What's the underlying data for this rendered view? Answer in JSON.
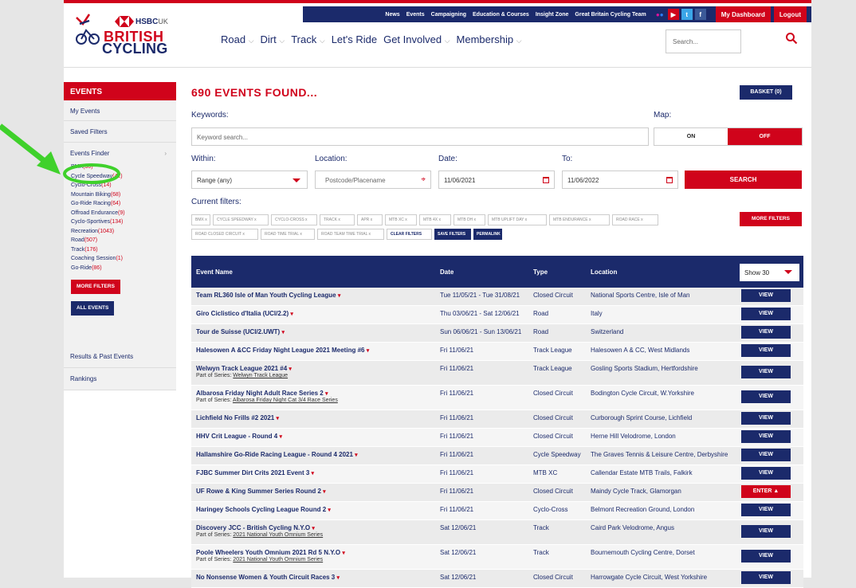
{
  "header": {
    "util_links": [
      "News",
      "Events",
      "Campaigning",
      "Education & Courses",
      "Insight Zone",
      "Great Britain Cycling Team"
    ],
    "my_dashboard": "My Dashboard",
    "logout": "Logout",
    "logo_hsbc": "HSBC",
    "logo_uk": "UK",
    "logo_line1": "BRITISH",
    "logo_line2": "CYCLING",
    "nav": [
      "Road",
      "Dirt",
      "Track",
      "Let's Ride",
      "Get Involved",
      "Membership"
    ],
    "search_placeholder": "Search..."
  },
  "sidebar": {
    "heading": "EVENTS",
    "my_events": "My Events",
    "saved_filters": "Saved Filters",
    "events_finder": "Events Finder",
    "categories": [
      {
        "name": "BMX",
        "count": "(30)"
      },
      {
        "name": "Cycle Speedway",
        "count": "(42)"
      },
      {
        "name": "Cyclo-Cross",
        "count": "(14)"
      },
      {
        "name": "Mountain Biking",
        "count": "(68)"
      },
      {
        "name": "Go-Ride Racing",
        "count": "(64)"
      },
      {
        "name": "Offroad Endurance",
        "count": "(9)"
      },
      {
        "name": "Cyclo-Sportives",
        "count": "(134)"
      },
      {
        "name": "Recreation",
        "count": "(1043)"
      },
      {
        "name": "Road",
        "count": "(507)"
      },
      {
        "name": "Track",
        "count": "(176)"
      },
      {
        "name": "Coaching Session",
        "count": "(1)"
      },
      {
        "name": "Go-Ride",
        "count": "(86)"
      }
    ],
    "more_filters": "MORE FILTERS",
    "all_events": "ALL EVENTS",
    "results": "Results & Past Events",
    "rankings": "Rankings"
  },
  "main": {
    "count_title": "690 EVENTS FOUND...",
    "basket": "BASKET (0)",
    "keywords_label": "Keywords:",
    "keywords_placeholder": "Keyword search...",
    "map_label": "Map:",
    "map_on": "ON",
    "map_off": "OFF",
    "within_label": "Within:",
    "within_value": "Range (any)",
    "location_label": "Location:",
    "location_placeholder": "Postcode/Placename",
    "date_label": "Date:",
    "date_value": "11/06/2021",
    "to_label": "To:",
    "to_value": "11/06/2022",
    "search_button": "SEARCH",
    "current_filters_label": "Current filters:",
    "filters_row1": [
      "BMX  x",
      "CYCLE SPEEDWAY  x",
      "CYCLO-CROSS  x",
      "TRACK  x",
      "APR  x",
      "MTB XC  x",
      "MTB 4X  x",
      "MTB DH  x",
      "MTB UPLIFT DAY  x",
      "MTB ENDURANCE  x",
      "ROAD RACE  x"
    ],
    "filters_row2": [
      "ROAD CLOSED CIRCUIT  x",
      "ROAD TIME TRIAL  x",
      "ROAD TEAM TIME TRIAL  x"
    ],
    "clear_filters": "CLEAR FILTERS",
    "save_filters": "SAVE FILTERS",
    "permalink": "PERMALINK",
    "more_filters": "MORE FILTERS"
  },
  "table": {
    "headers": {
      "name": "Event Name",
      "date": "Date",
      "type": "Type",
      "location": "Location"
    },
    "show": "Show 30",
    "rows": [
      {
        "name": "Team RL360 Isle of Man Youth Cycling League",
        "date": "Tue 11/05/21 - Tue 31/08/21",
        "type": "Closed Circuit",
        "location": "National Sports Centre, Isle of Man",
        "action": "VIEW",
        "series": ""
      },
      {
        "name": "Giro Ciclistico d'Italia (UCI/2.2)",
        "date": "Thu 03/06/21 - Sat 12/06/21",
        "type": "Road",
        "location": "Italy",
        "action": "VIEW",
        "series": ""
      },
      {
        "name": "Tour de Suisse (UCI/2.UWT)",
        "date": "Sun 06/06/21 - Sun 13/06/21",
        "type": "Road",
        "location": "Switzerland",
        "action": "VIEW",
        "series": ""
      },
      {
        "name": "Halesowen A &CC Friday Night League 2021 Meeting #6",
        "date": "Fri 11/06/21",
        "type": "Track League",
        "location": "Halesowen A & CC, West Midlands",
        "action": "VIEW",
        "series": ""
      },
      {
        "name": "Welwyn Track League 2021 #4",
        "date": "Fri 11/06/21",
        "type": "Track League",
        "location": "Gosling Sports Stadium, Hertfordshire",
        "action": "VIEW",
        "series": "Welwyn Track League"
      },
      {
        "name": "Albarosa Friday Night Adult Race Series 2",
        "date": "Fri 11/06/21",
        "type": "Closed Circuit",
        "location": "Bodington Cycle Circuit, W.Yorkshire",
        "action": "VIEW",
        "series": "Albarosa Friday Night Cat 3/4 Race Series"
      },
      {
        "name": "Lichfield No Frills #2 2021",
        "date": "Fri 11/06/21",
        "type": "Closed Circuit",
        "location": "Curborough Sprint Course, Lichfield",
        "action": "VIEW",
        "series": ""
      },
      {
        "name": "HHV Crit League - Round 4",
        "date": "Fri 11/06/21",
        "type": "Closed Circuit",
        "location": "Herne Hill Velodrome, London",
        "action": "VIEW",
        "series": ""
      },
      {
        "name": "Hallamshire Go-Ride Racing League - Round 4 2021",
        "date": "Fri 11/06/21",
        "type": "Cycle Speedway",
        "location": "The Graves Tennis & Leisure Centre, Derbyshire",
        "action": "VIEW",
        "series": ""
      },
      {
        "name": "FJBC Summer Dirt Crits 2021 Event 3",
        "date": "Fri 11/06/21",
        "type": "MTB XC",
        "location": "Callendar Estate MTB Trails, Falkirk",
        "action": "VIEW",
        "series": ""
      },
      {
        "name": "UF Rowe & King Summer Series Round 2",
        "date": "Fri 11/06/21",
        "type": "Closed Circuit",
        "location": "Maindy Cycle Track, Glamorgan",
        "action": "ENTER ▲",
        "series": ""
      },
      {
        "name": "Haringey Schools Cycling League Round 2",
        "date": "Fri 11/06/21",
        "type": "Cyclo-Cross",
        "location": "Belmont Recreation Ground, London",
        "action": "VIEW",
        "series": ""
      },
      {
        "name": "Discovery JCC - British Cycling N.Y.O",
        "date": "Sat 12/06/21",
        "type": "Track",
        "location": "Caird Park Velodrome, Angus",
        "action": "VIEW",
        "series": "2021 National Youth Omnium Series"
      },
      {
        "name": "Poole Wheelers Youth Omnium 2021 Rd 5 N.Y.O",
        "date": "Sat 12/06/21",
        "type": "Track",
        "location": "Bournemouth Cycling Centre, Dorset",
        "action": "VIEW",
        "series": "2021 National Youth Omnium Series"
      },
      {
        "name": "No Nonsense Women & Youth Circuit Races 3",
        "date": "Sat 12/06/21",
        "type": "Closed Circuit",
        "location": "Harrowgate Cycle Circuit, West Yorkshire",
        "action": "VIEW",
        "series": ""
      }
    ],
    "part_of_series": "Part of Series: "
  },
  "colors": {
    "brand_red": "#d0031b",
    "brand_navy": "#1b2a6b",
    "annotation_green": "#3fd12b"
  }
}
